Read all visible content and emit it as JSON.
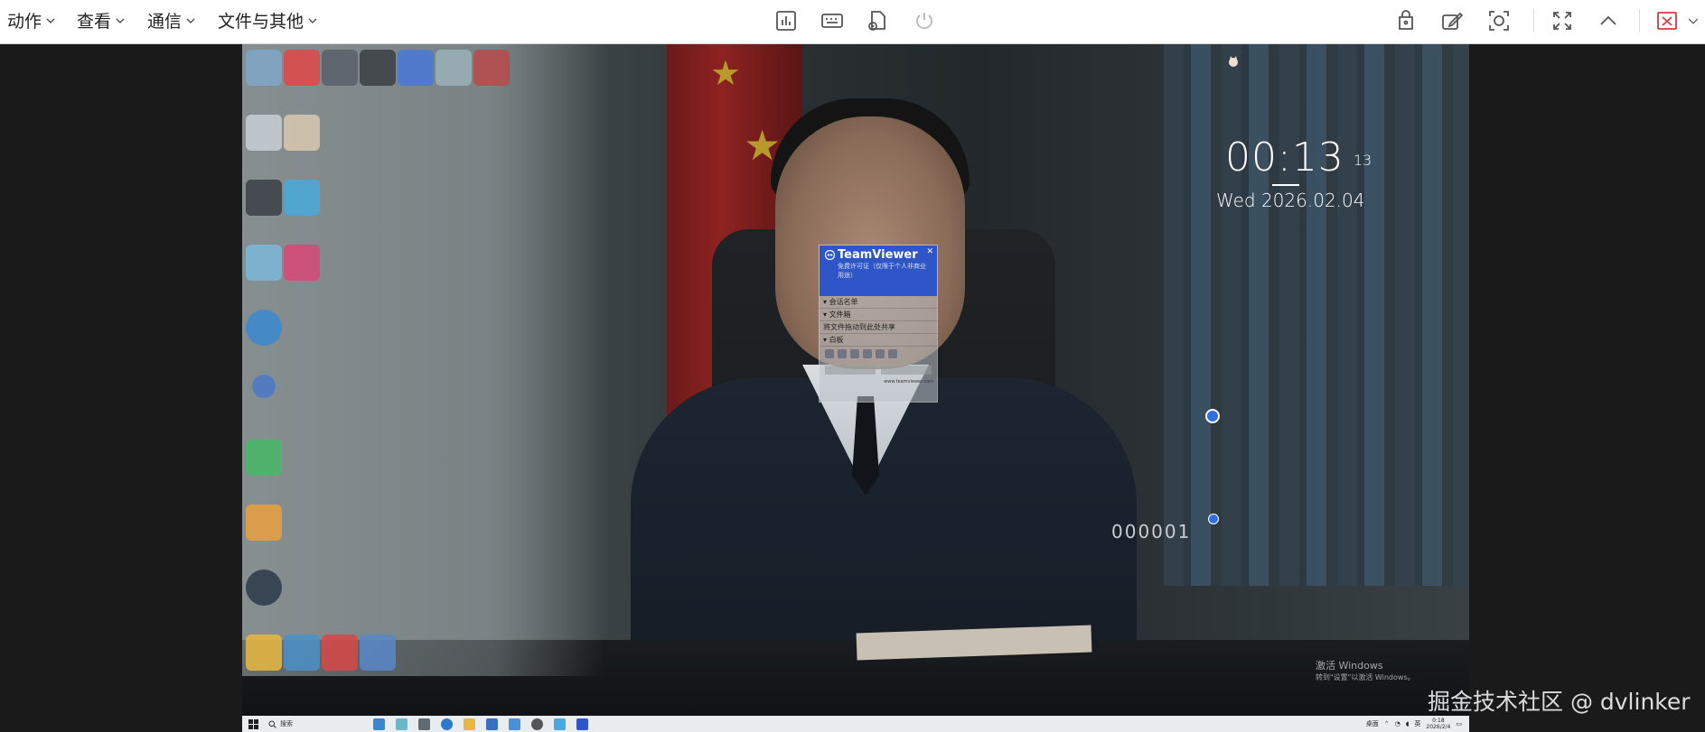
{
  "toolbar": {
    "menus": [
      {
        "label": "动作"
      },
      {
        "label": "查看"
      },
      {
        "label": "通信"
      },
      {
        "label": "文件与其他"
      }
    ],
    "center_icons": [
      "chart-icon",
      "keyboard-icon",
      "file-transfer-icon",
      "power-icon"
    ],
    "right_icons": [
      "lock-file-icon",
      "edit-icon",
      "screenshot-icon",
      "fullscreen-icon",
      "collapse-icon",
      "close-session-icon"
    ]
  },
  "remote_desktop": {
    "clock": {
      "time": "00:13",
      "seconds": "13",
      "date": "Wed 2026.02.04"
    },
    "uniform_number": "000001",
    "teamviewer": {
      "title": "TeamViewer",
      "subtitle": "免费许可证（仅限于个人非商业用途）",
      "rows": [
        "会话名单",
        "文件箱",
        "将文件拖动到此处共享",
        "白板"
      ],
      "footer": "www.teamviewer.com"
    },
    "activate_windows": {
      "line1": "激活 Windows",
      "line2": "转到\"设置\"以激活 Windows。"
    },
    "taskbar": {
      "search_placeholder": "搜索",
      "tray_label": "桌面",
      "ime": "英",
      "time": "0:18",
      "date": "2026/2/4"
    }
  },
  "site_watermark": "掘金技术社区 @ dvlinker"
}
